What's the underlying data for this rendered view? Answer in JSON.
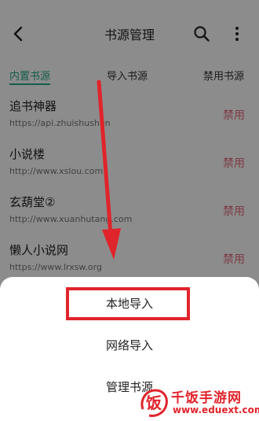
{
  "header": {
    "title": "书源管理"
  },
  "tabs": [
    {
      "label": "内置书源",
      "active": true
    },
    {
      "label": "导入书源",
      "active": false
    },
    {
      "label": "禁用书源",
      "active": false
    }
  ],
  "sources": [
    {
      "name": "追书神器",
      "url": "https://api.zhuishushen",
      "action": "禁用"
    },
    {
      "name": "小说楼",
      "url": "http://www.xslou.com",
      "action": "禁用"
    },
    {
      "name": "玄葫堂②",
      "url": "http://www.xuanhutang.com",
      "action": "禁用"
    },
    {
      "name": "懒人小说网",
      "url": "https://www.lrxsw.org",
      "action": "禁用"
    }
  ],
  "sheet": {
    "items": [
      "本地导入",
      "网络导入",
      "管理书源"
    ]
  },
  "watermark": {
    "name": "千饭手游网",
    "url": "www.eduext.com",
    "logo_char": "饭"
  },
  "colors": {
    "accent": "#28a98a",
    "disable_red": "#e26a78",
    "annotation_red": "#e0242b"
  }
}
